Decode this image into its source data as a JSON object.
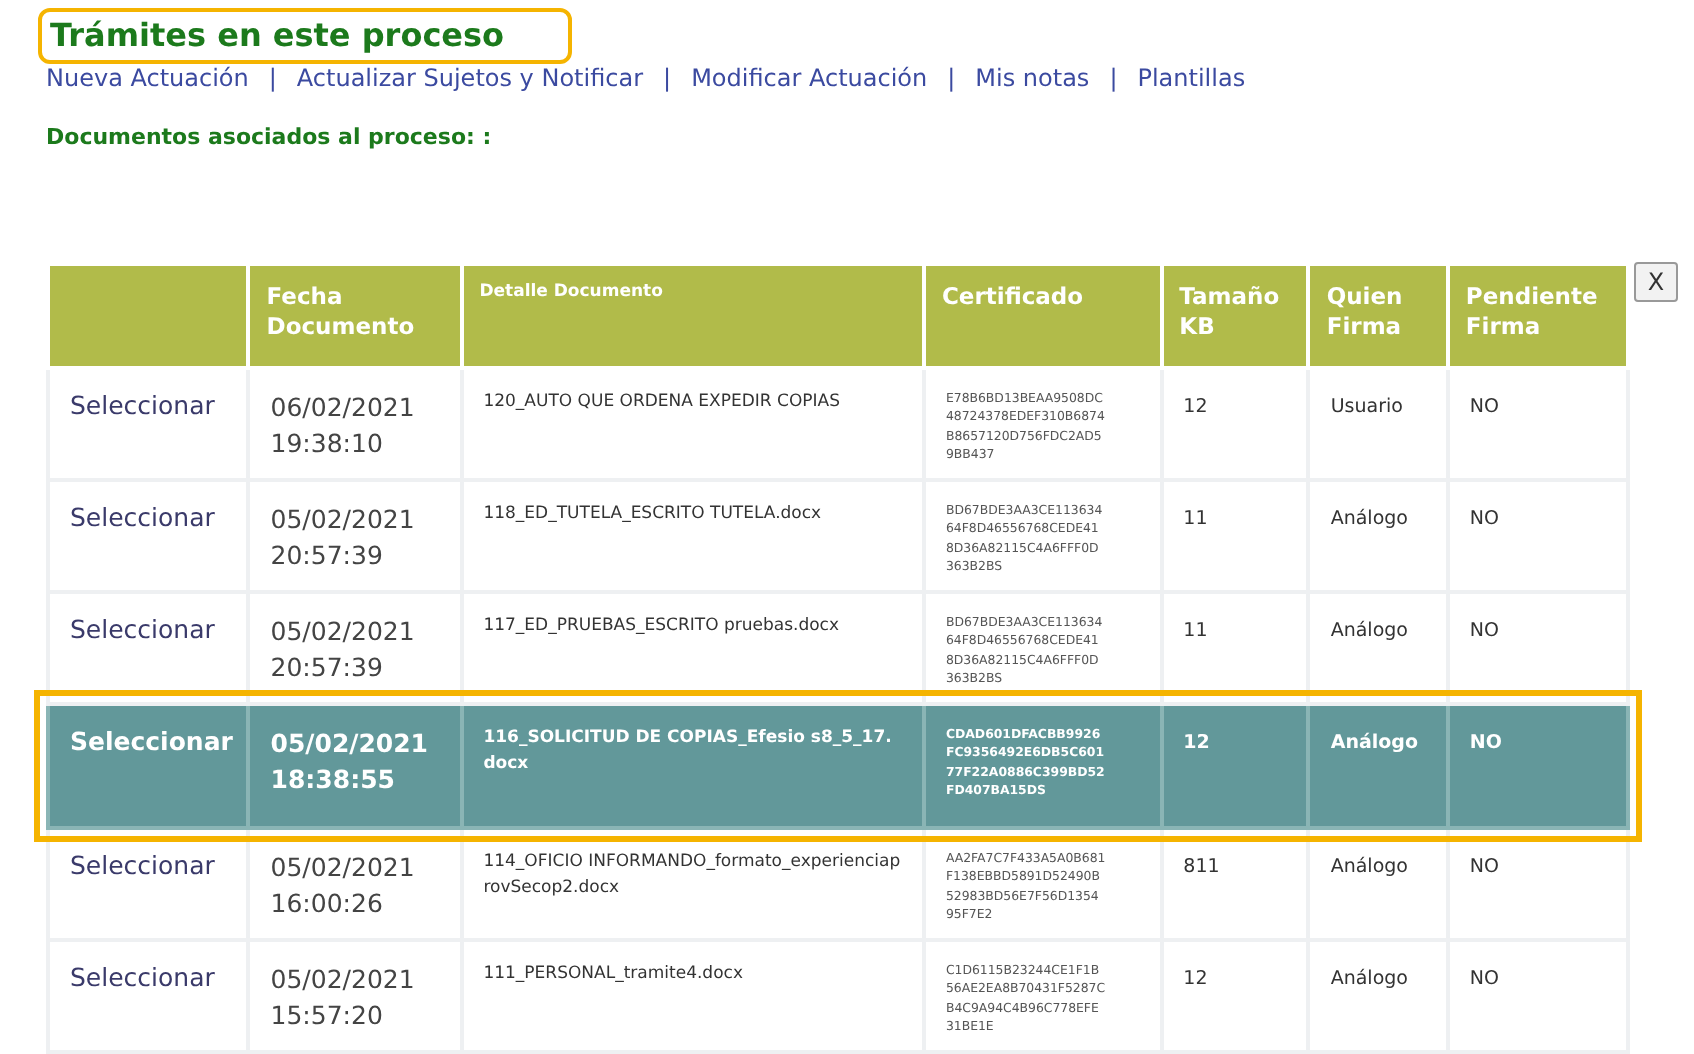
{
  "title": {
    "text": "Trámites en este proceso",
    "highlighted": true
  },
  "links": [
    "Nueva Actuación",
    "Actualizar Sujetos y Notificar",
    "Modificar Actuación",
    "Mis notas",
    "Plantillas"
  ],
  "link_separator": "|",
  "section_label": "Documentos asociados al proceso: :",
  "close_button": "X",
  "table": {
    "columns": [
      "",
      "Fecha Documento",
      "Detalle Documento",
      "Certificado",
      "Tamaño KB",
      "Quien Firma",
      "Pendiente Firma"
    ],
    "rows": [
      {
        "action": "Seleccionar",
        "date": "06/02/2021 19:38:10",
        "detail": "120_AUTO QUE ORDENA EXPEDIR COPIAS",
        "certificate": "E78B6BD13BEAA9508DC48724378EDEF310B6874B8657120D756FDC2AD59BB437",
        "size": "12",
        "signer": "Usuario",
        "pending": "NO",
        "selected": false
      },
      {
        "action": "Seleccionar",
        "date": "05/02/2021 20:57:39",
        "detail": "118_ED_TUTELA_ESCRITO TUTELA.docx",
        "certificate": "BD67BDE3AA3CE11363464F8D46556768CEDE418D36A82115C4A6FFF0D363B2BS",
        "size": "11",
        "signer": "Análogo",
        "pending": "NO",
        "selected": false
      },
      {
        "action": "Seleccionar",
        "date": "05/02/2021 20:57:39",
        "detail": "117_ED_PRUEBAS_ESCRITO pruebas.docx",
        "certificate": "BD67BDE3AA3CE11363464F8D46556768CEDE418D36A82115C4A6FFF0D363B2BS",
        "size": "11",
        "signer": "Análogo",
        "pending": "NO",
        "selected": false
      },
      {
        "action": "Seleccionar",
        "date": "05/02/2021 18:38:55",
        "detail": "116_SOLICITUD DE COPIAS_Efesio s8_5_17.docx",
        "certificate": "CDAD601DFACBB9926FC9356492E6DB5C60177F22A0886C399BD52FD407BA15DS",
        "size": "12",
        "signer": "Análogo",
        "pending": "NO",
        "selected": true
      },
      {
        "action": "Seleccionar",
        "date": "05/02/2021 16:00:26",
        "detail": "114_OFICIO INFORMANDO_formato_experienciaprovSecop2.docx",
        "certificate": "AA2FA7C7F433A5A0B681F138EBBD5891D52490B52983BD56E7F56D135495F7E2",
        "size": "811",
        "signer": "Análogo",
        "pending": "NO",
        "selected": false
      },
      {
        "action": "Seleccionar",
        "date": "05/02/2021 15:57:20",
        "detail": "111_PERSONAL_tramite4.docx",
        "certificate": "C1D6115B23244CE1F1B56AE2EA8B70431F5287CB4C9A94C4B96C778EFE31BE1E",
        "size": "12",
        "signer": "Análogo",
        "pending": "NO",
        "selected": false
      }
    ]
  }
}
